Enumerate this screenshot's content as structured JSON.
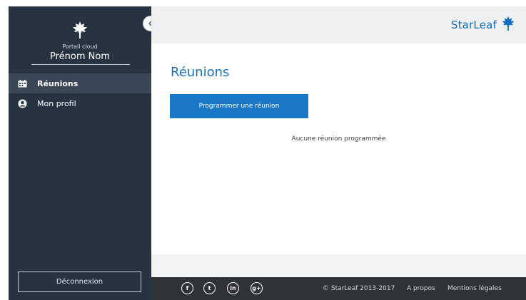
{
  "sidebar": {
    "portal_label": "Portail cloud",
    "user_name": "Prénom Nom",
    "items": [
      {
        "label": "Réunions",
        "icon": "calendar-icon"
      },
      {
        "label": "Mon profil",
        "icon": "profile-icon"
      }
    ],
    "logout_label": "Déconnexion"
  },
  "header": {
    "brand": "StarLeaf",
    "collapse_icon": "chevron-left-icon"
  },
  "main": {
    "title": "Réunions",
    "schedule_button": "Programmer une réunion",
    "empty_message": "Aucune réunion programmée"
  },
  "footer": {
    "social": [
      {
        "icon": "facebook-icon",
        "glyph": "f"
      },
      {
        "icon": "twitter-icon",
        "glyph": "t"
      },
      {
        "icon": "linkedin-icon",
        "glyph": "in"
      },
      {
        "icon": "googleplus-icon",
        "glyph": "g+"
      }
    ],
    "copyright": "© StarLeaf 2013-2017",
    "links": [
      "A propos",
      "Mentions légales"
    ]
  },
  "colors": {
    "sidebar_bg": "#273341",
    "accent": "#1b78c9",
    "footer_bg": "#2f3236"
  }
}
